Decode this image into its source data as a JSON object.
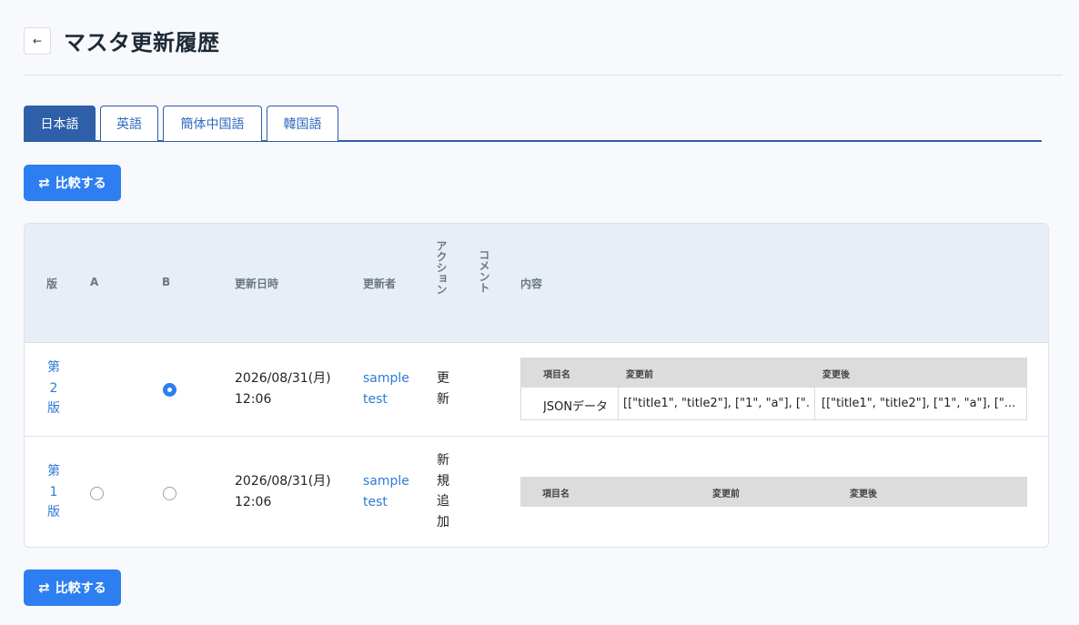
{
  "page": {
    "title": "マスタ更新履歴",
    "back_icon": "←"
  },
  "tabs": [
    {
      "label": "日本語",
      "active": true
    },
    {
      "label": "英語",
      "active": false
    },
    {
      "label": "簡体中国語",
      "active": false
    },
    {
      "label": "韓国語",
      "active": false
    }
  ],
  "compare_button": {
    "label": "比較する",
    "icon": "⇄"
  },
  "table": {
    "headers": {
      "version": "版",
      "a": "A",
      "b": "B",
      "updated_at": "更新日時",
      "updated_by": "更新者",
      "action": "アクション",
      "comment": "コメント",
      "content": "内容"
    },
    "rows": [
      {
        "version": "第2版",
        "a_selected": false,
        "b_selected": true,
        "date": "2026/08/31(月)",
        "time": "12:06",
        "user": "sample test",
        "action": "更新",
        "comment": "",
        "content": {
          "headers": [
            "項目名",
            "変更前",
            "変更後"
          ],
          "items": [
            {
              "name": "JSONデータ",
              "before": "[[\"title1\", \"title2\"], [\"1\", \"a\"], [\"...",
              "after": "[[\"title1\", \"title2\"], [\"1\", \"a\"], [\"..."
            }
          ]
        }
      },
      {
        "version": "第1版",
        "a_selected": false,
        "b_selected": false,
        "date": "2026/08/31(月)",
        "time": "12:06",
        "user": "sample test",
        "action": "新規追加",
        "comment": "",
        "content": {
          "headers": [
            "項目名",
            "変更前",
            "変更後"
          ],
          "items": []
        }
      }
    ]
  }
}
